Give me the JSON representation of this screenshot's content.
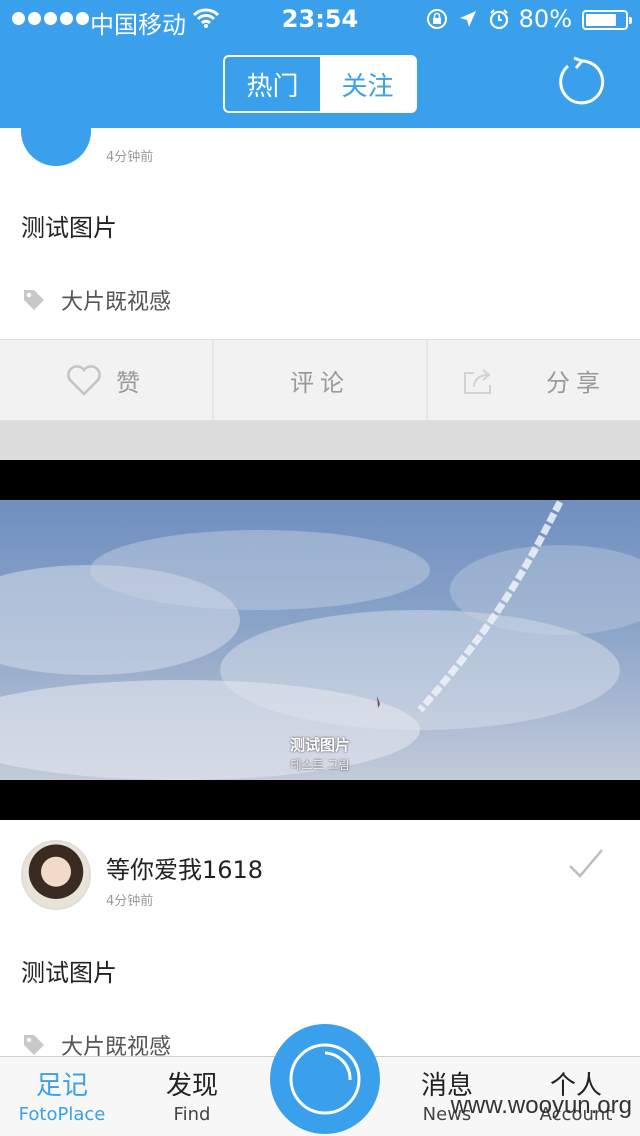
{
  "status_bar": {
    "carrier": "中国移动",
    "time": "23:54",
    "battery_percent": "80%",
    "battery_level": 0.8,
    "icons": [
      "signal-dots",
      "wifi-icon",
      "rotation-lock-icon",
      "location-arrow-icon",
      "alarm-icon",
      "battery-icon"
    ]
  },
  "nav": {
    "tabs": [
      {
        "label": "热门",
        "active": true
      },
      {
        "label": "关注",
        "active": false
      }
    ],
    "refresh_icon": "refresh-icon"
  },
  "posts": [
    {
      "time": "4分钟前",
      "text": "测试图片",
      "tag": "大片既视感"
    },
    {
      "username": "等你爱我1618",
      "time": "4分钟前",
      "text": "测试图片",
      "tag": "大片既视感"
    }
  ],
  "actions": {
    "like": "赞",
    "comment": "评论",
    "share": "分享"
  },
  "photo": {
    "caption_line1": "测试图片",
    "caption_line2": "테스트 그림"
  },
  "tabbar": {
    "items": [
      {
        "cn": "足记",
        "en": "FotoPlace",
        "active": true
      },
      {
        "cn": "发现",
        "en": "Find",
        "active": false
      },
      {
        "cn": "消息",
        "en": "News",
        "active": false
      },
      {
        "cn": "个人",
        "en": "Account",
        "active": false
      }
    ]
  },
  "watermark": "www.wooyun.org",
  "colors": {
    "accent": "#3aa0ec",
    "divider": "#dcdcdc"
  }
}
